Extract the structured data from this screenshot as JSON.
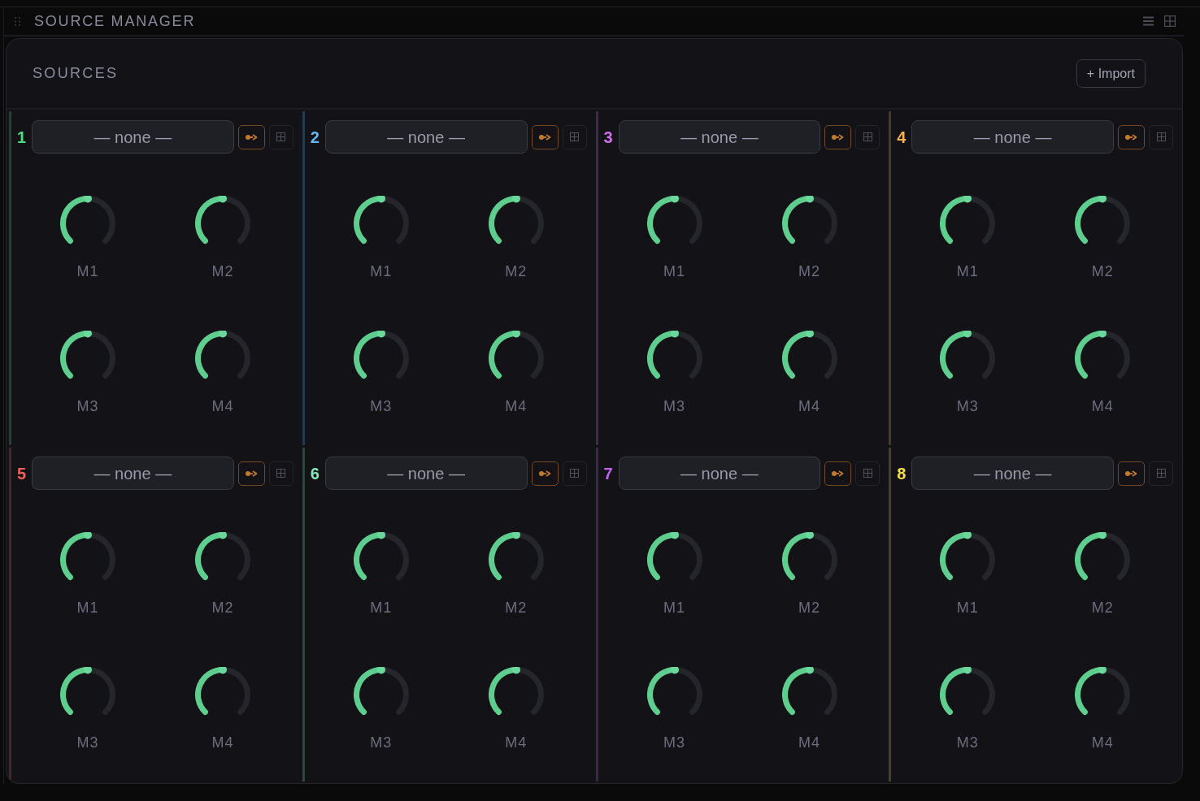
{
  "panel": {
    "title": "SOURCE MANAGER"
  },
  "sources": {
    "heading": "SOURCES",
    "import_button": "+ Import",
    "slots": [
      {
        "number": "1",
        "color": "#4ade80",
        "source": "— none —",
        "macros": [
          {
            "label": "M1",
            "level": 0.5
          },
          {
            "label": "M2",
            "level": 0.5
          },
          {
            "label": "M3",
            "level": 0.5
          },
          {
            "label": "M4",
            "level": 0.5
          }
        ]
      },
      {
        "number": "2",
        "color": "#60b8f6",
        "source": "— none —",
        "macros": [
          {
            "label": "M1",
            "level": 0.5
          },
          {
            "label": "M2",
            "level": 0.5
          },
          {
            "label": "M3",
            "level": 0.5
          },
          {
            "label": "M4",
            "level": 0.5
          }
        ]
      },
      {
        "number": "3",
        "color": "#d46ef0",
        "source": "— none —",
        "macros": [
          {
            "label": "M1",
            "level": 0.5
          },
          {
            "label": "M2",
            "level": 0.5
          },
          {
            "label": "M3",
            "level": 0.5
          },
          {
            "label": "M4",
            "level": 0.5
          }
        ]
      },
      {
        "number": "4",
        "color": "#f5b24e",
        "source": "— none —",
        "macros": [
          {
            "label": "M1",
            "level": 0.5
          },
          {
            "label": "M2",
            "level": 0.5
          },
          {
            "label": "M3",
            "level": 0.5
          },
          {
            "label": "M4",
            "level": 0.5
          }
        ]
      },
      {
        "number": "5",
        "color": "#f0625c",
        "source": "— none —",
        "macros": [
          {
            "label": "M1",
            "level": 0.5
          },
          {
            "label": "M2",
            "level": 0.5
          },
          {
            "label": "M3",
            "level": 0.5
          },
          {
            "label": "M4",
            "level": 0.5
          }
        ]
      },
      {
        "number": "6",
        "color": "#86eab8",
        "source": "— none —",
        "macros": [
          {
            "label": "M1",
            "level": 0.5
          },
          {
            "label": "M2",
            "level": 0.5
          },
          {
            "label": "M3",
            "level": 0.5
          },
          {
            "label": "M4",
            "level": 0.5
          }
        ]
      },
      {
        "number": "7",
        "color": "#c463f2",
        "source": "— none —",
        "macros": [
          {
            "label": "M1",
            "level": 0.5
          },
          {
            "label": "M2",
            "level": 0.5
          },
          {
            "label": "M3",
            "level": 0.5
          },
          {
            "label": "M4",
            "level": 0.5
          }
        ]
      },
      {
        "number": "8",
        "color": "#f5e04c",
        "source": "— none —",
        "macros": [
          {
            "label": "M1",
            "level": 0.5
          },
          {
            "label": "M2",
            "level": 0.5
          },
          {
            "label": "M3",
            "level": 0.5
          },
          {
            "label": "M4",
            "level": 0.5
          }
        ]
      }
    ]
  }
}
